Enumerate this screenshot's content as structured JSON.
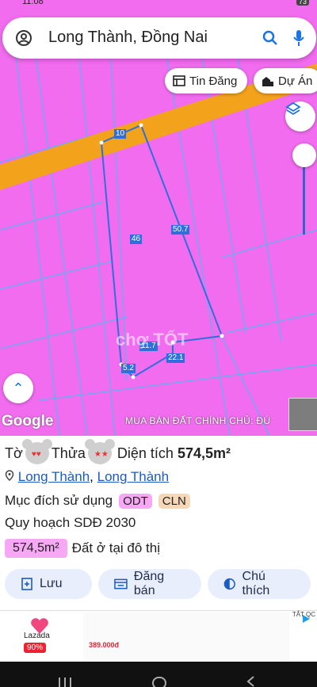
{
  "status": {
    "time": "11:08",
    "battery": "73"
  },
  "search": {
    "query": "Long Thành, Đồng Nai"
  },
  "chips": {
    "tin_dang": "Tin Đăng",
    "du_an": "Dự Án"
  },
  "map": {
    "attribution": "Google",
    "watermark": "MUA BÁN ĐẤT CHÍNH CHỦ: ĐÚ",
    "center_watermark": "chợ TỐT",
    "segments": {
      "top": "10",
      "left": "46",
      "right": "50.7",
      "mid": "11.7",
      "bottom_left": "5.2",
      "bottom": "22.1"
    },
    "colors": {
      "land": "#f26cf0",
      "road": "#f3a21c",
      "boundary": "#2f6fda"
    }
  },
  "info": {
    "to_label": "Tờ",
    "thua_label": "Thửa",
    "area_label": "Diện tích",
    "area_value": "574,5m²",
    "location": [
      "Long Thành",
      "Long Thành"
    ],
    "location_sep": ", ",
    "purpose_label": "Mục đích sử dụng",
    "purpose_tags": [
      {
        "code": "ODT",
        "color": "#f7a8f4"
      },
      {
        "code": "CLN",
        "color": "#f6d7b8"
      }
    ],
    "planning": "Quy hoạch SDĐ 2030",
    "plan_area": "574,5m²",
    "plan_type": "Đất ở tại đô thị"
  },
  "actions": {
    "save": "Lưu",
    "sell": "Đăng bán",
    "note": "Chú thích"
  },
  "ad": {
    "brand": "Lazada",
    "discount": "90%",
    "price": "389.000đ",
    "tag": "TẮT QC"
  }
}
